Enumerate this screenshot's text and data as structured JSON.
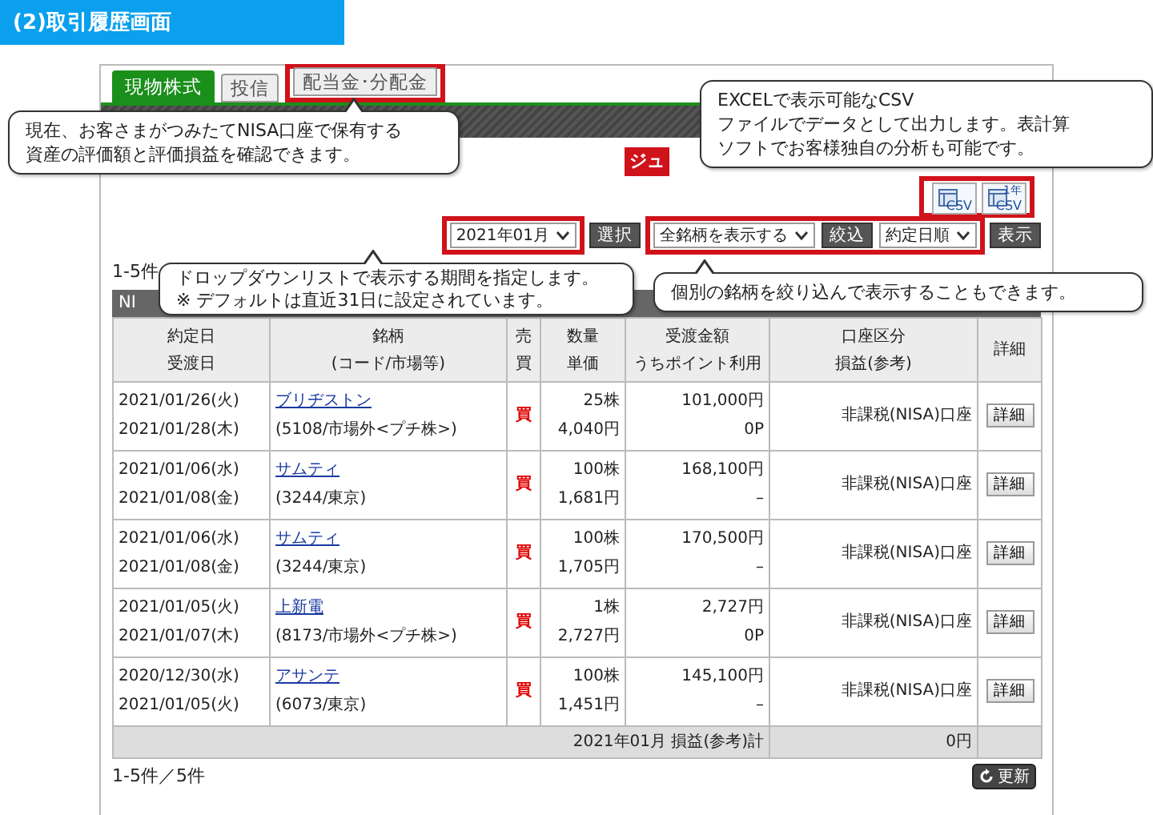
{
  "header": {
    "title": "(2)取引履歴画面"
  },
  "tabs": [
    {
      "label": "現物株式",
      "selected": true,
      "highlighted": false
    },
    {
      "label": "投信",
      "selected": false,
      "highlighted": false
    },
    {
      "label": "配当金･分配金",
      "selected": false,
      "highlighted": true
    }
  ],
  "badge": {
    "text": "ジュ"
  },
  "csv": {
    "highlighted": true,
    "buttons": [
      {
        "label": "CSV"
      },
      {
        "label": "CSV",
        "caption": "1年"
      }
    ]
  },
  "filters": {
    "period": {
      "value": "2021年01月",
      "highlighted": true
    },
    "period_button": "選択",
    "stock_group_highlighted": true,
    "stock": {
      "value": "全銘柄を表示する"
    },
    "filter_button": "絞込",
    "sort": {
      "value": "約定日順"
    },
    "show_button": "表示"
  },
  "count_top": "1-5件",
  "section_bar": "NI",
  "table": {
    "columns": [
      {
        "lines": [
          "約定日",
          "受渡日"
        ]
      },
      {
        "lines": [
          "銘柄",
          "(コード/市場等)"
        ]
      },
      {
        "lines": [
          "売",
          "買"
        ]
      },
      {
        "lines": [
          "数量",
          "単価"
        ]
      },
      {
        "lines": [
          "受渡金額",
          "うちポイント利用"
        ]
      },
      {
        "lines": [
          "口座区分",
          "損益(参考)"
        ]
      },
      {
        "lines": [
          "詳細"
        ]
      }
    ],
    "rows": [
      {
        "trade_date": "2021/01/26(火)",
        "settle_date": "2021/01/28(木)",
        "name": "ブリヂストン",
        "code": "(5108/市場外<プチ株>)",
        "side": "買",
        "qty": "25株",
        "price": "4,040円",
        "amount": "101,000円",
        "points": "0P",
        "account": "非課税(NISA)口座",
        "detail": "詳細"
      },
      {
        "trade_date": "2021/01/06(水)",
        "settle_date": "2021/01/08(金)",
        "name": "サムティ",
        "code": "(3244/東京)",
        "side": "買",
        "qty": "100株",
        "price": "1,681円",
        "amount": "168,100円",
        "points": "–",
        "account": "非課税(NISA)口座",
        "detail": "詳細"
      },
      {
        "trade_date": "2021/01/06(水)",
        "settle_date": "2021/01/08(金)",
        "name": "サムティ",
        "code": "(3244/東京)",
        "side": "買",
        "qty": "100株",
        "price": "1,705円",
        "amount": "170,500円",
        "points": "–",
        "account": "非課税(NISA)口座",
        "detail": "詳細"
      },
      {
        "trade_date": "2021/01/05(火)",
        "settle_date": "2021/01/07(木)",
        "name": "上新電",
        "code": "(8173/市場外<プチ株>)",
        "side": "買",
        "qty": "1株",
        "price": "2,727円",
        "amount": "2,727円",
        "points": "0P",
        "account": "非課税(NISA)口座",
        "detail": "詳細"
      },
      {
        "trade_date": "2020/12/30(水)",
        "settle_date": "2021/01/05(火)",
        "name": "アサンテ",
        "code": "(6073/東京)",
        "side": "買",
        "qty": "100株",
        "price": "1,451円",
        "amount": "145,100円",
        "points": "–",
        "account": "非課税(NISA)口座",
        "detail": "詳細"
      }
    ],
    "total": {
      "label": "2021年01月 損益(参考)計",
      "value": "0円"
    }
  },
  "count_bottom": "1-5件／5件",
  "refresh_button": "更新",
  "callouts": [
    {
      "lines": [
        "現在、お客さまがつみたてNISA口座で保有する",
        "資産の評価額と評価損益を確認できます。"
      ]
    },
    {
      "lines": [
        "EXCELで表示可能なCSV",
        "ファイルでデータとして出力します。表計算",
        "ソフトでお客様独自の分析も可能です。"
      ]
    },
    {
      "lines": [
        "ドロップダウンリストで表示する期間を指定します。",
        "※ デフォルトは直近31日に設定されています。"
      ]
    },
    {
      "lines": [
        "個別の銘柄を絞り込んで表示することもできます。"
      ]
    }
  ]
}
